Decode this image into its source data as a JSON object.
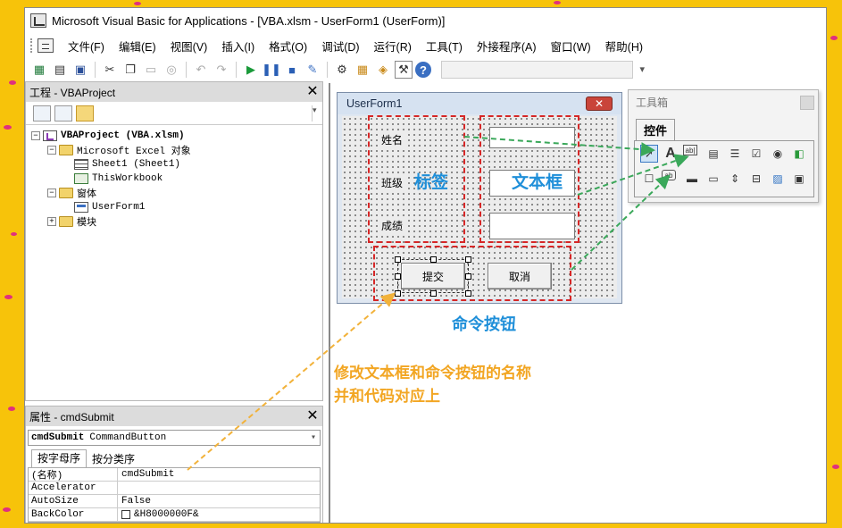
{
  "window": {
    "title": "Microsoft Visual Basic for Applications - [VBA.xlsm - UserForm1 (UserForm)]"
  },
  "menu": [
    "文件(F)",
    "编辑(E)",
    "视图(V)",
    "插入(I)",
    "格式(O)",
    "调试(D)",
    "运行(R)",
    "工具(T)",
    "外接程序(A)",
    "窗口(W)",
    "帮助(H)"
  ],
  "project": {
    "title": "工程 - VBAProject",
    "tree": {
      "root": "VBAProject (VBA.xlsm)",
      "excel_objects": "Microsoft Excel 对象",
      "sheet1": "Sheet1 (Sheet1)",
      "workbook": "ThisWorkbook",
      "forms": "窗体",
      "userform": "UserForm1",
      "modules": "模块"
    }
  },
  "properties": {
    "title": "属性 - cmdSubmit",
    "object_name": "cmdSubmit",
    "object_type": "CommandButton",
    "tabs": [
      "按字母序",
      "按分类序"
    ],
    "rows": [
      {
        "key": "(名称)",
        "value": "cmdSubmit"
      },
      {
        "key": "Accelerator",
        "value": ""
      },
      {
        "key": "AutoSize",
        "value": "False"
      },
      {
        "key": "BackColor",
        "value": "&H8000000F&"
      }
    ]
  },
  "userform": {
    "title": "UserForm1",
    "close": "✕",
    "labels": [
      "姓名",
      "班级",
      "成绩"
    ],
    "buttons": {
      "submit": "提交",
      "cancel": "取消"
    }
  },
  "toolbox": {
    "title": "工具箱",
    "tab": "控件"
  },
  "annotations": {
    "label_note": "标签",
    "textbox_note": "文本框",
    "button_note": "命令按钮",
    "tip_line1": "修改文本框和命令按钮的名称",
    "tip_line2": "并和代码对应上"
  },
  "colors": {
    "background": "#f7c30a",
    "annotation_blue": "#1f8fd9",
    "annotation_orange": "#f2a623",
    "red_box": "#d62727",
    "arrow_green": "#3aa85a"
  }
}
